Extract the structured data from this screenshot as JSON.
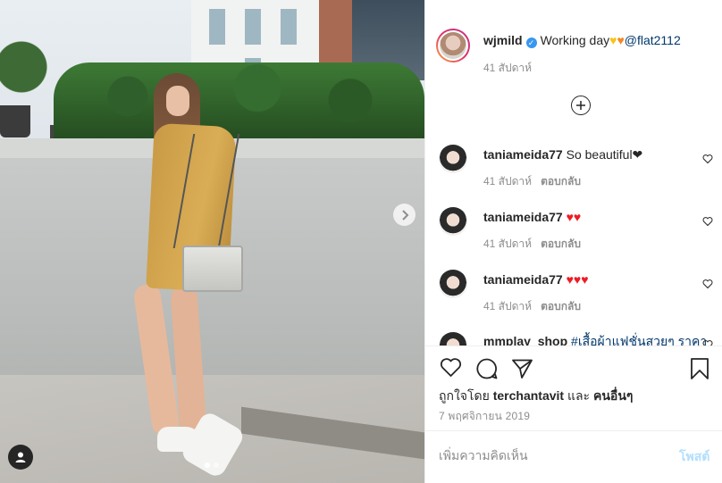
{
  "post": {
    "author": {
      "username": "wjmild",
      "verified": true
    },
    "caption": {
      "text": "Working day",
      "mention": "@flat2112",
      "emoji": [
        "yellow-heart",
        "orange-heart"
      ]
    },
    "caption_time": "41 สัปดาห์",
    "likes": {
      "prefix": "ถูกใจโดย",
      "user": "terchantavit",
      "joiner": "และ",
      "others": "คนอื่นๆ"
    },
    "date": "7 พฤศจิกายน 2019",
    "carousel": {
      "current": 1,
      "total": 2
    }
  },
  "comments": [
    {
      "username": "taniameida77",
      "text": "So beautiful❤",
      "hearts": 0,
      "time": "41 สัปดาห์",
      "reply": "ตอบกลับ"
    },
    {
      "username": "taniameida77",
      "text": "",
      "hearts": 2,
      "time": "41 สัปดาห์",
      "reply": "ตอบกลับ"
    },
    {
      "username": "taniameida77",
      "text": "",
      "hearts": 3,
      "time": "41 สัปดาห์",
      "reply": "ตอบกลับ"
    },
    {
      "username": "mmplay_shop",
      "text": "#เสื้อผ้าแฟชั่นสวยๆ ราคา",
      "hearts": 0,
      "time": "",
      "reply": ""
    }
  ],
  "comment_input": {
    "placeholder": "เพิ่มความคิดเห็น",
    "post_label": "โพสต์"
  },
  "colors": {
    "verified": "#3897f0",
    "link": "#00376b",
    "muted": "#8e8e8e",
    "post_disabled": "#b2dffc",
    "red_heart": "#ed1c24"
  },
  "icons": [
    "chevron-right-icon",
    "user-tag-icon",
    "plus-circle-icon",
    "heart-icon",
    "comment-icon",
    "share-icon",
    "bookmark-icon"
  ]
}
